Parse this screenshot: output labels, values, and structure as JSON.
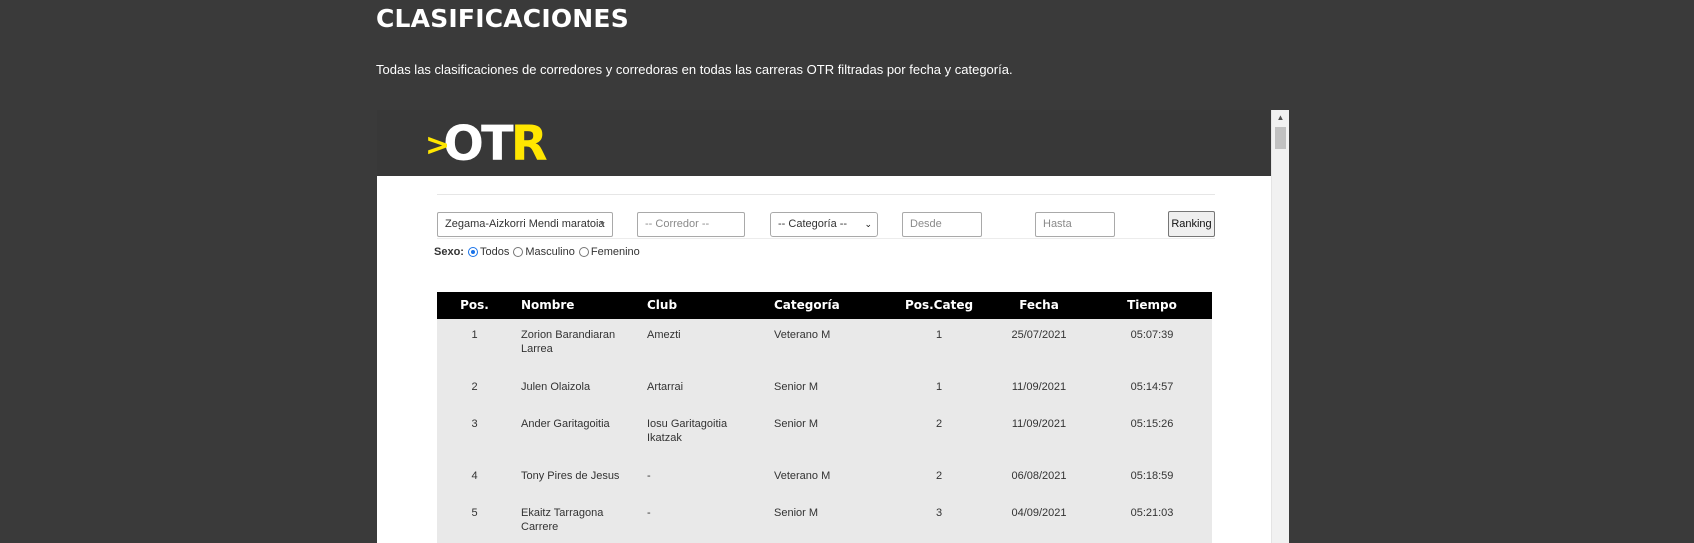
{
  "page": {
    "title": "CLASIFICACIONES",
    "description": "Todas las clasificaciones de corredores y corredoras en todas las carreras OTR filtradas por fecha y categoría."
  },
  "logo": {
    "chevron": ">",
    "ot": "OT",
    "r": "R"
  },
  "filters": {
    "race_selected": "Zegama-Aizkorri Mendi maratoia",
    "corredor_placeholder": "-- Corredor --",
    "categoria_selected": "-- Categoría --",
    "desde_placeholder": "Desde",
    "hasta_placeholder": "Hasta",
    "ranking_button": "Ranking",
    "sexo_label": "Sexo:",
    "sexo_options": [
      "Todos",
      "Masculino",
      "Femenino"
    ],
    "sexo_selected": "Todos"
  },
  "table": {
    "headers": [
      "Pos.",
      "Nombre",
      "Club",
      "Categoría",
      "Pos.Categ",
      "Fecha",
      "Tiempo"
    ],
    "rows": [
      {
        "pos": "1",
        "nombre": "Zorion Barandiaran Larrea",
        "club": "Amezti",
        "categoria": "Veterano M",
        "poscateg": "1",
        "fecha": "25/07/2021",
        "tiempo": "05:07:39"
      },
      {
        "pos": "2",
        "nombre": "Julen Olaizola",
        "club": "Artarrai",
        "categoria": "Senior M",
        "poscateg": "1",
        "fecha": "11/09/2021",
        "tiempo": "05:14:57"
      },
      {
        "pos": "3",
        "nombre": "Ander Garitagoitia",
        "club": "Iosu Garitagoitia Ikatzak",
        "categoria": "Senior M",
        "poscateg": "2",
        "fecha": "11/09/2021",
        "tiempo": "05:15:26"
      },
      {
        "pos": "4",
        "nombre": "Tony Pires de Jesus",
        "club": "-",
        "categoria": "Veterano M",
        "poscateg": "2",
        "fecha": "06/08/2021",
        "tiempo": "05:18:59"
      },
      {
        "pos": "5",
        "nombre": "Ekaitz Tarragona Carrere",
        "club": "-",
        "categoria": "Senior M",
        "poscateg": "3",
        "fecha": "04/09/2021",
        "tiempo": "05:21:03"
      }
    ]
  },
  "scrollbar": {
    "up_icon": "▲"
  }
}
